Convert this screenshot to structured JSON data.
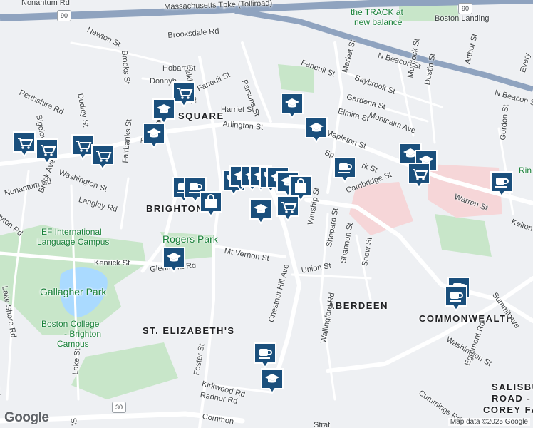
{
  "colors": {
    "land": "#eef0f3",
    "park": "#c8e6c9",
    "water": "#aadaff",
    "highway": "#8fa3bf",
    "hospital": "#f6d6d8",
    "pin": "#1a4f7c",
    "pin_border": "#ffffff"
  },
  "labels": {
    "nonantum_rd_top": "Nonantum Rd",
    "mass_pike": "Massachusetts Tpke (Tolliroad)",
    "track": "the TRACK at",
    "track2": "new balance",
    "boston_landing": "Boston Landing",
    "newton_st": "Newton St",
    "brooksdale_rd": "Brooksdale Rd",
    "n_beacon_st": "N Beacon St",
    "n_beacon_st2": "N Beacon St",
    "faneuil_st": "Faneuil St",
    "faneuil_st2": "Faneuil St",
    "market_st": "Market St",
    "saybrook_st": "Saybrook St",
    "arthur_st": "Arthur St",
    "everett_st": "Every",
    "perthshire_rd": "Perthshire Rd",
    "bigelow_st": "Bigelow St",
    "dudley_st": "Dudley St",
    "hobart_st": "Hobart St",
    "donnybrook": "Donnyb",
    "falkland_st": "Falkland St",
    "brooks_st": "Brooks St",
    "gardena_st": "Gardena St",
    "montcalm_ave": "Montcalm Ave",
    "murdock_st": "Murdock St",
    "dustin_st": "Dustin St",
    "harriet_st": "Harriet St",
    "parsons_st": "Parsons St",
    "elmira_st": "Elmira St",
    "square": "SQUARE",
    "arlington_st": "Arlington St",
    "mapleton_st": "Mapleton St",
    "spark_st": "Sp",
    "spark_st2": "rk St",
    "gordon_st": "Gordon St",
    "fairbanks_st": "Fairbanks St",
    "turner_st": "Turn",
    "beechcroft": "Beechc",
    "washington_st": "Washington St",
    "nonantum_rd": "Nonantum Rd",
    "breck_ave": "Breck Ave",
    "langley_rd": "Langley Rd",
    "cambridge_st": "Cambridge St",
    "warren_st": "Warren St",
    "rink": "Rin",
    "brighton": "BRIGHTON",
    "ayton_rd": "ayton Rd",
    "ef_campus": "EF International",
    "ef_campus2": "Language Campus",
    "rogers_park": "Rogers Park",
    "winship_st": "Winship St",
    "shepard_st": "Shepard St",
    "shannon_st": "Shannon St",
    "snow_st": "Snow St",
    "kelton_st": "Kelton",
    "mt_vernon_st": "Mt Vernon St",
    "kenrick_st": "Kenrick St",
    "glenmont_rd": "Glenmont Rd",
    "lake_shore_rd": "Lake Shore Rd",
    "union_st": "Union St",
    "gallagher_park": "Gallagher Park",
    "chestnut_hill_ave": "Chestnut Hill Ave",
    "aberdeen": "ABERDEEN",
    "commonwealth": "COMMONWEALTH",
    "summit_ave": "Summit Ave",
    "bc_campus": "Boston College",
    "bc_campus2": "- Brighton",
    "bc_campus3": "Campus",
    "st_elizabeths": "ST. ELIZABETH'S",
    "wallingford_rd": "Wallingford Rd",
    "washington_st2": "Washington St",
    "egremont_rd": "Egremont Rd",
    "lake_st": "Lake St",
    "foster_st": "Foster St",
    "kirkwood_rd": "Kirkwood Rd",
    "radnor_rd": "Radnor Rd",
    "cummings_rd": "Cummings Rd",
    "salisbury1": "SALISBU",
    "salisbury2": "ROAD -",
    "salisbury3": "COREY FA",
    "common": "Common",
    "st_rd": "St",
    "bottom_road": "Strat",
    "rd_left": "Rd",
    "route30": "30",
    "route90a": "90",
    "route90b": "90"
  },
  "pins": [
    {
      "icon": "cart"
    },
    {
      "icon": "graduation"
    },
    {
      "icon": "graduation"
    },
    {
      "icon": "graduation"
    },
    {
      "icon": "cart"
    },
    {
      "icon": "cart"
    },
    {
      "icon": "cart"
    },
    {
      "icon": "cart"
    },
    {
      "icon": "cup"
    },
    {
      "icon": "cup"
    },
    {
      "icon": "bag"
    },
    {
      "icon": "restaurant"
    },
    {
      "icon": "graduation"
    },
    {
      "icon": "graduation"
    },
    {
      "icon": "graduation"
    },
    {
      "icon": "restaurant"
    },
    {
      "icon": "graduation"
    },
    {
      "icon": "graduation"
    },
    {
      "icon": "bag"
    },
    {
      "icon": "graduation"
    },
    {
      "icon": "cart"
    },
    {
      "icon": "cup"
    },
    {
      "icon": "graduation"
    },
    {
      "icon": "graduation"
    },
    {
      "icon": "graduation"
    },
    {
      "icon": "cart"
    },
    {
      "icon": "cup"
    },
    {
      "icon": "cup"
    },
    {
      "icon": "graduation"
    },
    {
      "icon": "cup"
    },
    {
      "icon": "cup"
    },
    {
      "icon": "graduation"
    }
  ],
  "attribution": "Map data ©2025 Google",
  "logo": "Google"
}
